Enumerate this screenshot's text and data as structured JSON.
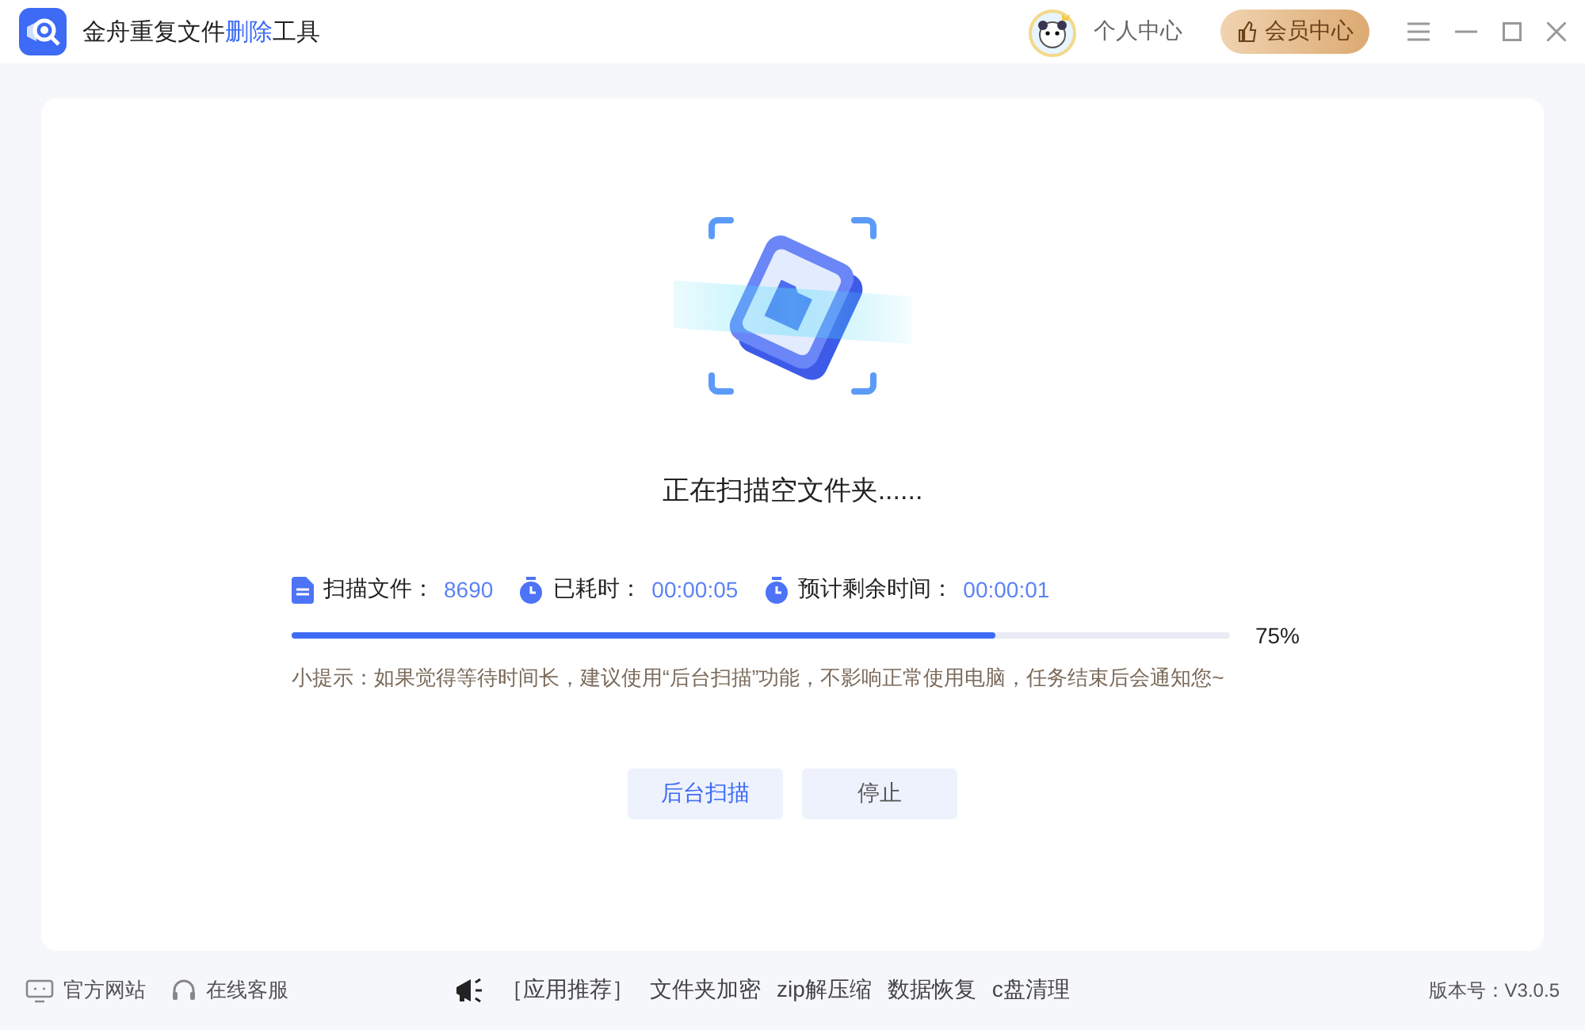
{
  "window": {
    "title": "金舟重复文件",
    "title_highlight": "删除",
    "title_suffix": "工具"
  },
  "header": {
    "user": "个人中心",
    "vip": "会员中心"
  },
  "scan": {
    "status": "正在扫描空文件夹......",
    "stats": [
      {
        "label": "扫描文件：",
        "value": "8690",
        "kind": "file"
      },
      {
        "label": "已耗时：",
        "value": "00:00:05",
        "kind": "timer"
      },
      {
        "label": "预计剩余时间：",
        "value": "00:00:01",
        "kind": "timer"
      }
    ],
    "progress": {
      "level": 0.75,
      "reading": "75%"
    },
    "tip": "小提示：如果觉得等待时间长，建议使用“后台扫描”功能，不影响正常使用电脑，任务结束后会通知您~",
    "buttons": [
      "后台扫描",
      "停止"
    ]
  },
  "footer": {
    "links": [
      {
        "label": "官方网站",
        "kind": "web"
      },
      {
        "label": "在线客服",
        "kind": "headset"
      }
    ],
    "promo_label": "［应用推荐］",
    "apps": [
      "文件夹加密",
      "zip解压缩",
      "数据恢复",
      "c盘清理"
    ],
    "version": "版本号：V3.0.5"
  }
}
